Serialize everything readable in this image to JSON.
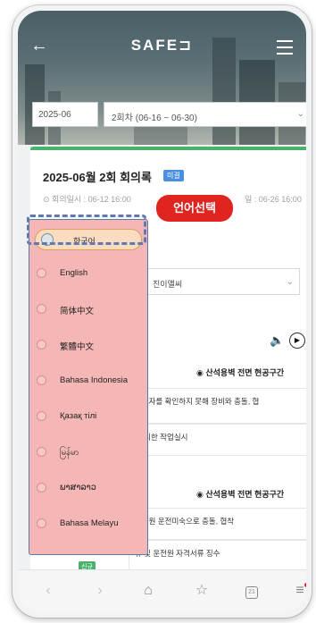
{
  "header": {
    "logo": "SAFE⊐",
    "back_icon": "arrow-left-icon",
    "menu_icon": "hamburger-icon"
  },
  "selectors": {
    "month": "2025-06",
    "round": "2회차 (06-16 ~ 06-30)"
  },
  "document": {
    "title": "2025-06월 2회 회의록",
    "badge": "미결",
    "meeting_date": "⊙ 회의일시 : 06-12 16:00",
    "write_date": "일 : 06-26 16:00",
    "writer": "진이앨씨"
  },
  "sections": [
    {
      "title": "◉ 산석용벽 전면 현공구간",
      "rows": [
        "근로자를 확인하지 못해 장비와 충돌, 협",
        "에 의한 작업실시"
      ]
    },
    {
      "title": "◉ 산석용벽 전면 현공구간",
      "rows": [
        "운전원 운전미숙으로 충돌, 협착",
        "류 및 운전원 자격서류 징수"
      ]
    }
  ],
  "language_dropdown": {
    "current": "한국어",
    "options": [
      "English",
      "简体中文",
      "繁體中文",
      "Bahasa Indonesia",
      "Қазақ тілі",
      "မြန်မာ",
      "ພາສາລາວ",
      "Bahasa Melayu"
    ]
  },
  "callout": "언어선택",
  "new_tag": "신규",
  "bottom_nav": {
    "back": "‹",
    "forward": "›",
    "home": "⌂",
    "star": "☆",
    "tabs": "21",
    "more": "≡"
  },
  "colors": {
    "callout": "#e0241f",
    "dropdown_bg": "#f5b7b5",
    "highlight_border": "#5d7bb0",
    "accent_green": "#47b36a",
    "badge_blue": "#4a90e2"
  }
}
